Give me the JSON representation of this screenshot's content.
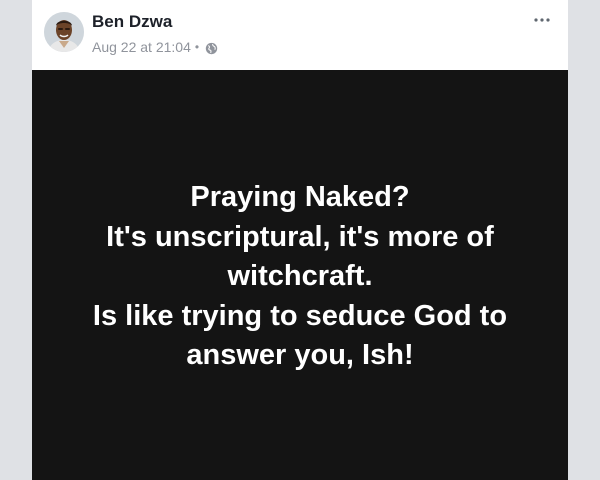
{
  "post": {
    "author": {
      "name": "Ben Dzwa",
      "avatar_icon": "profile-photo"
    },
    "timestamp": "Aug 22 at 21:04",
    "separator": "•",
    "privacy_icon": "globe-icon",
    "more_icon": "ellipsis-horizontal-icon",
    "image_text_lines": [
      "Praying Naked?",
      "It's unscriptural, it's more of",
      "witchcraft.",
      "Is like trying to seduce God to",
      "answer you, Ish!"
    ],
    "colors": {
      "image_background": "#141414",
      "image_text": "#ffffff",
      "page_background": "#dfe1e5",
      "author_name": "#1d2129",
      "meta_text": "#90949c"
    }
  }
}
